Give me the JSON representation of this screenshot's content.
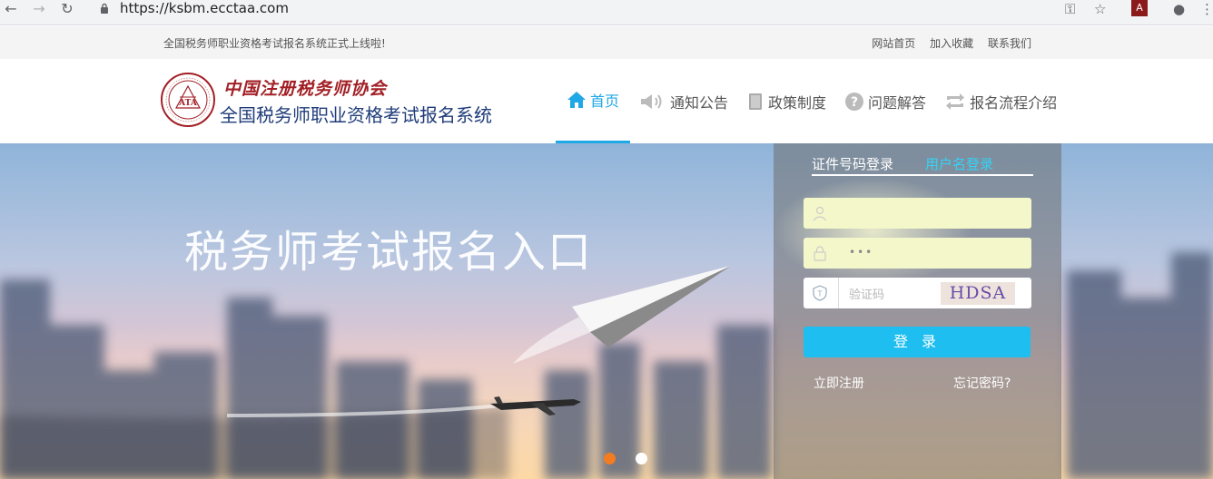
{
  "browser": {
    "url": "https://ksbm.ecctaa.com"
  },
  "topbar": {
    "notice": "全国税务师职业资格考试报名系统正式上线啦!",
    "links": [
      "网站首页",
      "加入收藏",
      "联系我们"
    ]
  },
  "logo": {
    "org_name": "中国注册税务师协会",
    "seal_text": "ATA",
    "system_name": "全国税务师职业资格考试报名系统"
  },
  "nav": {
    "items": [
      {
        "label": "首页",
        "icon": "home-icon",
        "active": true
      },
      {
        "label": "通知公告",
        "icon": "speaker-icon"
      },
      {
        "label": "政策制度",
        "icon": "book-icon"
      },
      {
        "label": "问题解答",
        "icon": "question-icon"
      },
      {
        "label": "报名流程介绍",
        "icon": "flow-icon"
      }
    ]
  },
  "hero": {
    "title": "税务师考试报名入口",
    "slide_count": 2,
    "active_slide": 1
  },
  "login": {
    "tabs": [
      "证件号码登录",
      "用户名登录"
    ],
    "active_tab": 1,
    "captcha_placeholder": "验证码",
    "captcha_text": "HDSA",
    "submit_label": "登 录",
    "register_link": "立即注册",
    "forgot_link": "忘记密码?"
  },
  "colors": {
    "accent": "#20a7e6",
    "button": "#1ebef0",
    "logo_red": "#a21f25",
    "logo_blue": "#1f3c7a",
    "dot_active": "#f47c20"
  }
}
